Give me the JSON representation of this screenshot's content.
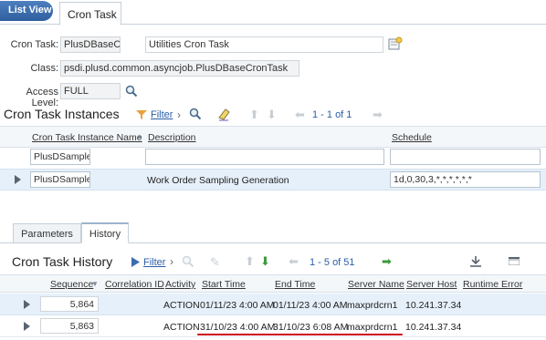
{
  "top_tabs": {
    "list_view": "List View",
    "cron_task": "Cron Task"
  },
  "header": {
    "cron_task_label": "Cron Task:",
    "cron_task_value": "PlusDBaseCro",
    "description_value": "Utilities Cron Task",
    "class_label": "Class:",
    "class_value": "psdi.plusd.common.asyncjob.PlusDBaseCronTask",
    "access_level_label": "Access Level:",
    "access_level_value": "FULL"
  },
  "instances": {
    "title": "Cron Task Instances",
    "filter_label": "Filter",
    "pager": "1 - 1 of 1",
    "columns": [
      "Cron Task Instance Name",
      "Description",
      "Schedule"
    ],
    "filter_value": "PlusDSample\\",
    "row": {
      "name": "PlusDSampleW",
      "description": "Work Order Sampling Generation",
      "schedule": "1d,0,30,3,*,*,*,*,*,*"
    }
  },
  "sub_tabs": {
    "parameters": "Parameters",
    "history": "History"
  },
  "history": {
    "title": "Cron Task History",
    "filter_label": "Filter",
    "pager": "1 - 5 of 51",
    "columns": [
      "Sequence",
      "Correlation ID",
      "Activity",
      "Start Time",
      "End Time",
      "Server Name",
      "Server Host",
      "Runtime Error"
    ],
    "rows": [
      {
        "sequence": "5,864",
        "correlation": "",
        "activity": "ACTION",
        "start": "01/11/23 4:00 AM",
        "end": "01/11/23 4:00 AM",
        "server_name": "maxprdcrn1",
        "server_host": "10.241.37.34",
        "runtime_error": ""
      },
      {
        "sequence": "5,863",
        "correlation": "",
        "activity": "ACTION",
        "start": "31/10/23 4:00 AM",
        "end": "31/10/23 6:08 AM",
        "server_name": "maxprdcrn1",
        "server_host": "10.241.37.34",
        "runtime_error": ""
      }
    ]
  },
  "colors": {
    "accent": "#2a5ea8",
    "highlight_underline": "#d0021b",
    "green_arrow": "#3a9a3a"
  }
}
